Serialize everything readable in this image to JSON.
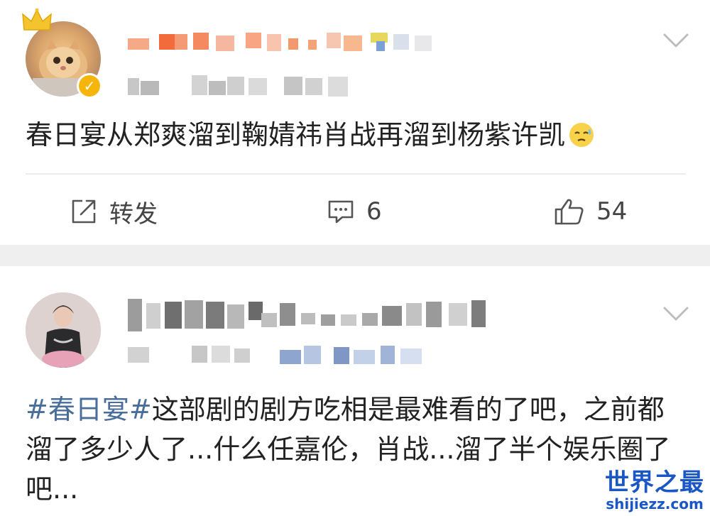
{
  "post1": {
    "text": "春日宴从郑爽溜到鞠婧祎肖战再溜到杨紫许凯",
    "emoji": "sweat-face-emoji",
    "actions": {
      "repost_label": "转发",
      "comment_count": "6",
      "like_count": "54"
    }
  },
  "post2": {
    "hashtag": "#春日宴#",
    "text": "这部剧的剧方吃相是最难看的了吧，之前都溜了多少人了...什么任嘉伦，肖战...溜了半个娱乐圈了吧..."
  },
  "watermark": {
    "title": "世界之最",
    "url": "shijiezz.com"
  },
  "colors": {
    "hashtag": "#4a6e9c",
    "separator": "#efefef",
    "badge": "#f5b50b"
  }
}
